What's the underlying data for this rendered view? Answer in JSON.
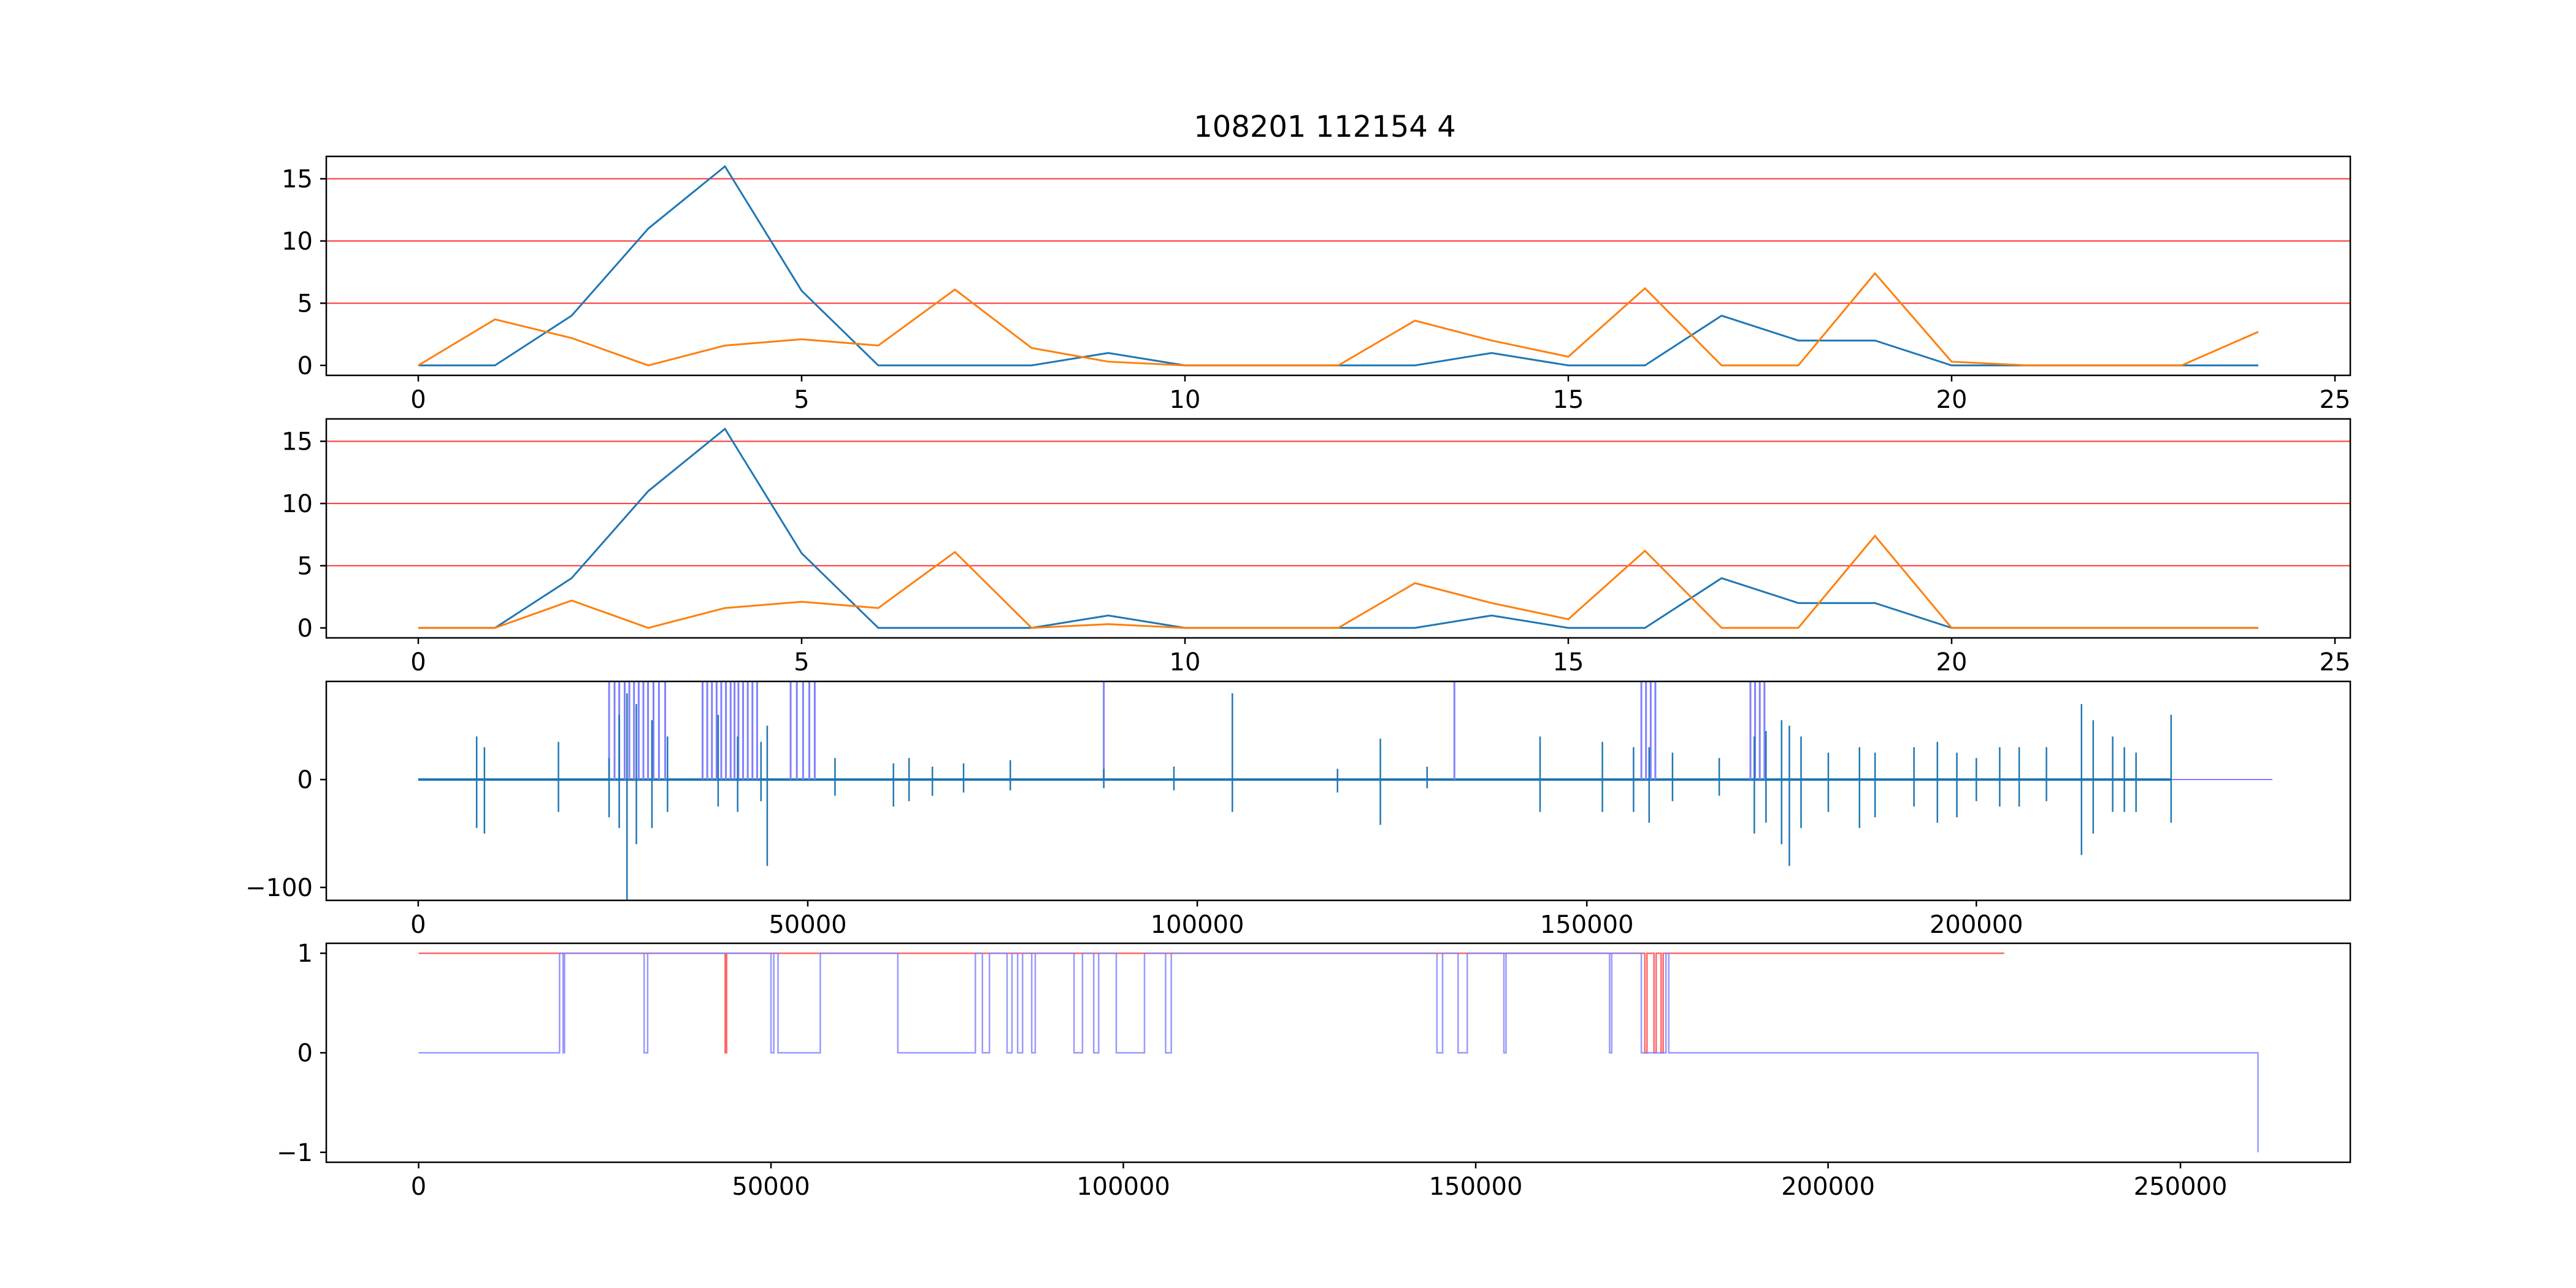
{
  "title": "108201 112154 4",
  "colors": {
    "series_blue": "#1f77b4",
    "series_orange": "#ff7f0e",
    "threshold_red": "#ff0000",
    "trace_blue": "#1f77b4",
    "flag_light_blue": "#8080ff",
    "flag_red": "#ff4040",
    "frame": "#000000"
  },
  "chart_data": [
    {
      "type": "line",
      "panel": 1,
      "title": "108201 112154 4",
      "x": [
        0,
        1,
        2,
        3,
        4,
        5,
        6,
        7,
        8,
        9,
        10,
        11,
        12,
        13,
        14,
        15,
        16,
        17,
        18,
        19,
        20,
        21,
        22,
        23,
        24
      ],
      "series": [
        {
          "color": "#1f77b4",
          "values": [
            0,
            0,
            4,
            11,
            16,
            6,
            0,
            0,
            0,
            1,
            0,
            0,
            0,
            0,
            1,
            0,
            0,
            4,
            2,
            2,
            0,
            0,
            0,
            0,
            0
          ]
        },
        {
          "color": "#ff7f0e",
          "values": [
            0,
            3.7,
            2.2,
            0,
            1.6,
            2.1,
            1.6,
            6.1,
            1.4,
            0.3,
            0,
            0,
            0,
            3.6,
            2,
            0.7,
            6.2,
            0,
            0,
            7.4,
            0.3,
            0,
            0,
            0,
            2.7
          ]
        }
      ],
      "hlines": [
        5,
        10,
        15
      ],
      "xlim": [
        -1.2,
        25.2
      ],
      "ylim": [
        -0.8,
        16.8
      ],
      "xticks": [
        0,
        5,
        10,
        15,
        20,
        25
      ],
      "yticks": [
        0,
        5,
        10,
        15
      ]
    },
    {
      "type": "line",
      "panel": 2,
      "x": [
        0,
        1,
        2,
        3,
        4,
        5,
        6,
        7,
        8,
        9,
        10,
        11,
        12,
        13,
        14,
        15,
        16,
        17,
        18,
        19,
        20,
        21,
        22,
        23,
        24
      ],
      "series": [
        {
          "color": "#1f77b4",
          "values": [
            0,
            0,
            4,
            11,
            16,
            6,
            0,
            0,
            0,
            1,
            0,
            0,
            0,
            0,
            1,
            0,
            0,
            4,
            2,
            2,
            0,
            0,
            0,
            0,
            0
          ]
        },
        {
          "color": "#ff7f0e",
          "values": [
            0,
            0,
            2.2,
            0,
            1.6,
            2.1,
            1.6,
            6.1,
            0,
            0.3,
            0,
            0,
            0,
            3.6,
            2,
            0.7,
            6.2,
            0,
            0,
            7.4,
            0,
            0,
            0,
            0,
            0
          ]
        }
      ],
      "hlines": [
        5,
        10,
        15
      ],
      "xlim": [
        -1.2,
        25.2
      ],
      "ylim": [
        -0.8,
        16.8
      ],
      "xticks": [
        0,
        5,
        10,
        15,
        20,
        25
      ],
      "yticks": [
        0,
        5,
        10,
        15
      ]
    },
    {
      "type": "line",
      "panel": 3,
      "description_of_signal": "blue trace with sparse spikes; light-blue vertical marker bars clipped at top",
      "xlim": [
        -11800,
        248000
      ],
      "ylim": [
        -112,
        91
      ],
      "xticks": [
        0,
        50000,
        100000,
        150000,
        200000
      ],
      "yticks": [
        -100,
        0
      ],
      "baseline_end": 238000,
      "trace_end": 225000,
      "spikes": [
        [
          7500,
          -45,
          40
        ],
        [
          8500,
          -50,
          30
        ],
        [
          18000,
          -30,
          35
        ],
        [
          24500,
          -35,
          20
        ],
        [
          25800,
          -45,
          60
        ],
        [
          26800,
          -112,
          80
        ],
        [
          28000,
          -60,
          70
        ],
        [
          30000,
          -45,
          55
        ],
        [
          32000,
          -30,
          40
        ],
        [
          38500,
          -25,
          60
        ],
        [
          41000,
          -30,
          40
        ],
        [
          44000,
          -20,
          35
        ],
        [
          44800,
          -80,
          50
        ],
        [
          53500,
          -15,
          20
        ],
        [
          61000,
          -25,
          15
        ],
        [
          63000,
          -20,
          20
        ],
        [
          66000,
          -15,
          12
        ],
        [
          70000,
          -12,
          15
        ],
        [
          76000,
          -10,
          18
        ],
        [
          88000,
          -8,
          10
        ],
        [
          97000,
          -10,
          12
        ],
        [
          104500,
          -30,
          80
        ],
        [
          118000,
          -12,
          10
        ],
        [
          123500,
          -42,
          38
        ],
        [
          129500,
          -8,
          12
        ],
        [
          144000,
          -30,
          40
        ],
        [
          152000,
          -30,
          35
        ],
        [
          156000,
          -30,
          30
        ],
        [
          158000,
          -40,
          30
        ],
        [
          161000,
          -20,
          25
        ],
        [
          167000,
          -15,
          20
        ],
        [
          171500,
          -50,
          40
        ],
        [
          173000,
          -40,
          45
        ],
        [
          175000,
          -60,
          55
        ],
        [
          176000,
          -80,
          50
        ],
        [
          177500,
          -45,
          40
        ],
        [
          181000,
          -30,
          25
        ],
        [
          185000,
          -45,
          30
        ],
        [
          187000,
          -35,
          25
        ],
        [
          192000,
          -25,
          30
        ],
        [
          195000,
          -40,
          35
        ],
        [
          197500,
          -35,
          25
        ],
        [
          200000,
          -20,
          20
        ],
        [
          203000,
          -25,
          30
        ],
        [
          205500,
          -25,
          30
        ],
        [
          209000,
          -20,
          30
        ],
        [
          213500,
          -70,
          70
        ],
        [
          215000,
          -50,
          55
        ],
        [
          217500,
          -30,
          40
        ],
        [
          219000,
          -30,
          30
        ],
        [
          220500,
          -30,
          25
        ],
        [
          225000,
          -40,
          60
        ]
      ],
      "markers": [
        24500,
        25200,
        25800,
        26500,
        27100,
        27700,
        28300,
        28900,
        29500,
        30200,
        30900,
        31700,
        36500,
        37100,
        37700,
        38300,
        38900,
        39500,
        40100,
        40600,
        41100,
        41700,
        42300,
        42900,
        43500,
        47800,
        48600,
        49400,
        50200,
        50900,
        88000,
        133000,
        157000,
        157600,
        158200,
        158800,
        171000,
        171600,
        172200,
        172800
      ]
    },
    {
      "type": "line",
      "panel": 4,
      "xlim": [
        -13100,
        274100
      ],
      "ylim": [
        -1.1,
        1.1
      ],
      "xticks": [
        0,
        50000,
        100000,
        150000,
        200000,
        250000
      ],
      "yticks": [
        -1,
        0,
        1
      ],
      "red_series": [
        [
          0,
          1
        ],
        [
          43500,
          1
        ],
        [
          43500,
          0
        ],
        [
          43700,
          0
        ],
        [
          43700,
          1
        ],
        [
          174000,
          1
        ],
        [
          174000,
          0
        ],
        [
          174300,
          0
        ],
        [
          174300,
          1
        ],
        [
          175300,
          1
        ],
        [
          175300,
          0
        ],
        [
          175600,
          0
        ],
        [
          175600,
          1
        ],
        [
          176300,
          1
        ],
        [
          176300,
          0
        ],
        [
          176600,
          0
        ],
        [
          176600,
          1
        ],
        [
          225000,
          1
        ]
      ],
      "blue_series": [
        [
          0,
          0
        ],
        [
          20000,
          0
        ],
        [
          20000,
          1
        ],
        [
          20500,
          1
        ],
        [
          20500,
          0
        ],
        [
          20700,
          0
        ],
        [
          20700,
          1
        ],
        [
          32000,
          1
        ],
        [
          32000,
          0
        ],
        [
          32500,
          0
        ],
        [
          32500,
          1
        ],
        [
          50000,
          1
        ],
        [
          50000,
          0
        ],
        [
          50400,
          0
        ],
        [
          50400,
          1
        ],
        [
          51000,
          1
        ],
        [
          51000,
          0
        ],
        [
          57000,
          0
        ],
        [
          57000,
          1
        ],
        [
          68000,
          1
        ],
        [
          68000,
          0
        ],
        [
          79000,
          0
        ],
        [
          79000,
          1
        ],
        [
          80000,
          1
        ],
        [
          80000,
          0
        ],
        [
          81000,
          0
        ],
        [
          81000,
          1
        ],
        [
          83500,
          1
        ],
        [
          83500,
          0
        ],
        [
          84200,
          0
        ],
        [
          84200,
          1
        ],
        [
          85000,
          1
        ],
        [
          85000,
          0
        ],
        [
          85700,
          0
        ],
        [
          85700,
          1
        ],
        [
          87000,
          1
        ],
        [
          87000,
          0
        ],
        [
          87500,
          0
        ],
        [
          87500,
          1
        ],
        [
          93000,
          1
        ],
        [
          93000,
          0
        ],
        [
          94200,
          0
        ],
        [
          94200,
          1
        ],
        [
          95800,
          1
        ],
        [
          95800,
          0
        ],
        [
          96500,
          0
        ],
        [
          96500,
          1
        ],
        [
          99000,
          1
        ],
        [
          99000,
          0
        ],
        [
          103000,
          0
        ],
        [
          103000,
          1
        ],
        [
          106000,
          1
        ],
        [
          106000,
          0
        ],
        [
          106800,
          0
        ],
        [
          106800,
          1
        ],
        [
          144500,
          1
        ],
        [
          144500,
          0
        ],
        [
          145300,
          0
        ],
        [
          145300,
          1
        ],
        [
          147500,
          1
        ],
        [
          147500,
          0
        ],
        [
          148800,
          0
        ],
        [
          148800,
          1
        ],
        [
          154000,
          1
        ],
        [
          154000,
          0
        ],
        [
          154300,
          0
        ],
        [
          154300,
          1
        ],
        [
          169000,
          1
        ],
        [
          169000,
          0
        ],
        [
          169300,
          0
        ],
        [
          169300,
          1
        ],
        [
          173500,
          1
        ],
        [
          173500,
          0
        ],
        [
          177000,
          0
        ],
        [
          177000,
          1
        ],
        [
          177400,
          1
        ],
        [
          177400,
          0
        ],
        [
          261000,
          0
        ],
        [
          261000,
          -1
        ]
      ]
    }
  ]
}
